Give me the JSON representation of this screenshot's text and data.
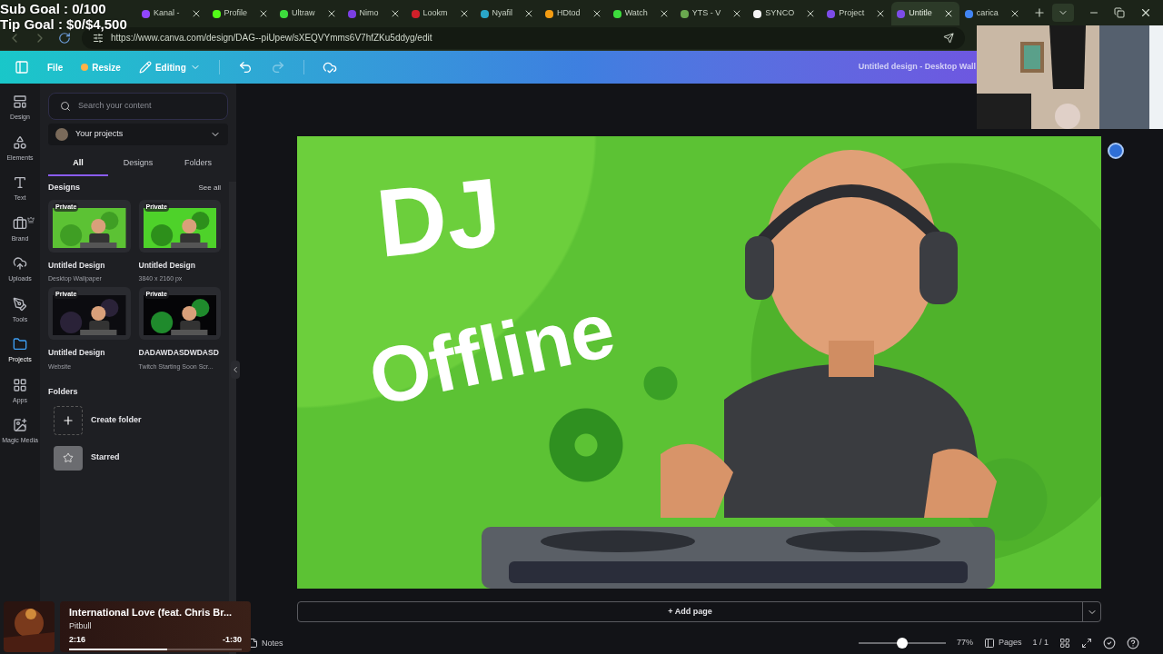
{
  "overlay": {
    "lines": [
      "Sub Goal : 0/100",
      "Tip Goal : $0/$4,500"
    ]
  },
  "browser": {
    "tabs": [
      {
        "label": "Kanal -",
        "selected": false,
        "color": "#9146ff"
      },
      {
        "label": "Profile",
        "selected": false,
        "color": "#53fc18"
      },
      {
        "label": "Ultraw",
        "selected": false,
        "color": "#3ddc3d"
      },
      {
        "label": "Nimo",
        "selected": false,
        "color": "#7b3fe4"
      },
      {
        "label": "Lookm",
        "selected": false,
        "color": "#d0202a"
      },
      {
        "label": "Nyafil",
        "selected": false,
        "color": "#2aa6c9"
      },
      {
        "label": "HDtod",
        "selected": false,
        "color": "#f39c12"
      },
      {
        "label": "Watch",
        "selected": false,
        "color": "#3ddc3d"
      },
      {
        "label": "YTS - V",
        "selected": false,
        "color": "#6aa84f"
      },
      {
        "label": "SYNCO",
        "selected": false,
        "color": "#f5f5f5"
      },
      {
        "label": "Project",
        "selected": false,
        "color": "#7d4ce8"
      },
      {
        "label": "Untitle",
        "selected": true,
        "color": "#7d4ce8"
      },
      {
        "label": "carica",
        "selected": false,
        "color": "#4285f4"
      }
    ],
    "url": "https://www.canva.com/design/DAG--piUpew/sXEQVYmms6V7hfZKu5ddyg/edit"
  },
  "toolbar": {
    "file": "File",
    "resize": "Resize",
    "editing": "Editing",
    "redo_disabled": true,
    "title": "Untitled design - Desktop Wall"
  },
  "rail": [
    {
      "label": "Design",
      "selected": false
    },
    {
      "label": "Elements",
      "selected": false
    },
    {
      "label": "Text",
      "selected": false
    },
    {
      "label": "Brand",
      "selected": false
    },
    {
      "label": "Uploads",
      "selected": false
    },
    {
      "label": "Tools",
      "selected": false
    },
    {
      "label": "Projects",
      "selected": true
    },
    {
      "label": "Apps",
      "selected": false
    },
    {
      "label": "Magic Media",
      "selected": false
    }
  ],
  "panel": {
    "search": {
      "placeholder": "Search your content"
    },
    "owner": "Your projects",
    "tabs": [
      {
        "label": "All",
        "selected": true
      },
      {
        "label": "Designs",
        "selected": false
      },
      {
        "label": "Folders",
        "selected": false
      }
    ],
    "designs_heading": "Designs",
    "see_all": "See all",
    "designs": [
      {
        "badge": "Private",
        "title": "Untitled Design",
        "subtitle": "Desktop Wallpaper",
        "kind": "green"
      },
      {
        "badge": "Private",
        "title": "Untitled Design",
        "subtitle": "3840 x 2160 px",
        "kind": "lime"
      },
      {
        "badge": "Private",
        "title": "Untitled Design",
        "subtitle": "Website",
        "kind": "dark"
      },
      {
        "badge": "Private",
        "title": "DADAWDASDWDASD",
        "subtitle": "Twitch Starting Soon Scr...",
        "kind": "night"
      }
    ],
    "folders_heading": "Folders",
    "folders": [
      {
        "label": "Create folder",
        "kind": "create"
      },
      {
        "label": "Starred",
        "kind": "starred"
      }
    ]
  },
  "canvas": {
    "design_texts": [
      "DJ",
      "Offline"
    ],
    "add_page": "+ Add page"
  },
  "player": {
    "title": "International Love (feat. Chris Br...",
    "artist": "Pitbull",
    "elapsed": "2:16",
    "remaining": "-1:30",
    "level": 0.57
  },
  "footer": {
    "notes": "Notes",
    "zoom": {
      "level": 0.5
    },
    "zoom_reading": "77%",
    "pages": "Pages",
    "page_count": "1 / 1"
  }
}
